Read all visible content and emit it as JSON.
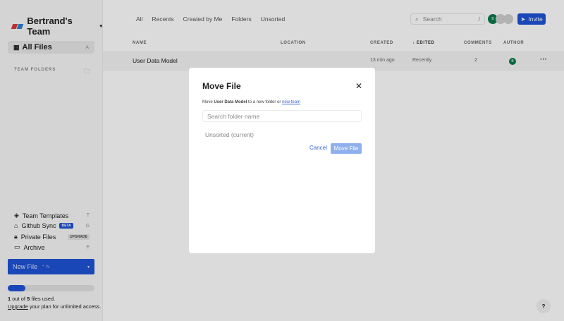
{
  "sidebar": {
    "team_name": "Bertrand's Team",
    "all_files": "All Files",
    "all_files_key": "A",
    "team_folders": "TEAM FOLDERS",
    "items": [
      {
        "label": "Team Templates",
        "key": "T"
      },
      {
        "label": "Github Sync",
        "badge": "BETA",
        "key": "G"
      },
      {
        "label": "Private Files",
        "badge": "UPGRADE"
      },
      {
        "label": "Archive",
        "key": "E"
      }
    ],
    "new_file": "New File",
    "new_file_key": "⌃ N",
    "usage_fraction": 0.2,
    "used_count": "1",
    "used_mid": " out of ",
    "used_total": "5",
    "used_tail": " files used.",
    "upgrade_link": "Upgrade",
    "upgrade_tail": " your plan for unlimited access."
  },
  "topnav": [
    "All",
    "Recents",
    "Created by Me",
    "Folders",
    "Unsorted"
  ],
  "search": {
    "placeholder": "Search",
    "shortcut": "/"
  },
  "avatar_initial": "B",
  "invite": "Invite",
  "table": {
    "headers": [
      "NAME",
      "LOCATION",
      "CREATED",
      "EDITED",
      "COMMENTS",
      "AUTHOR"
    ],
    "rows": [
      {
        "name": "User Data Model",
        "location": "",
        "created": "13 min ago",
        "edited": "Recently",
        "comments": "2",
        "author": "B"
      }
    ]
  },
  "modal": {
    "title": "Move File",
    "desc_pre": "Move ",
    "desc_file": "User Data Model",
    "desc_mid": " to a new folder or ",
    "desc_link": "new team",
    "search_placeholder": "Search folder name",
    "option": "Unsorted (current)",
    "cancel": "Cancel",
    "confirm": "Move File"
  },
  "help": "?"
}
